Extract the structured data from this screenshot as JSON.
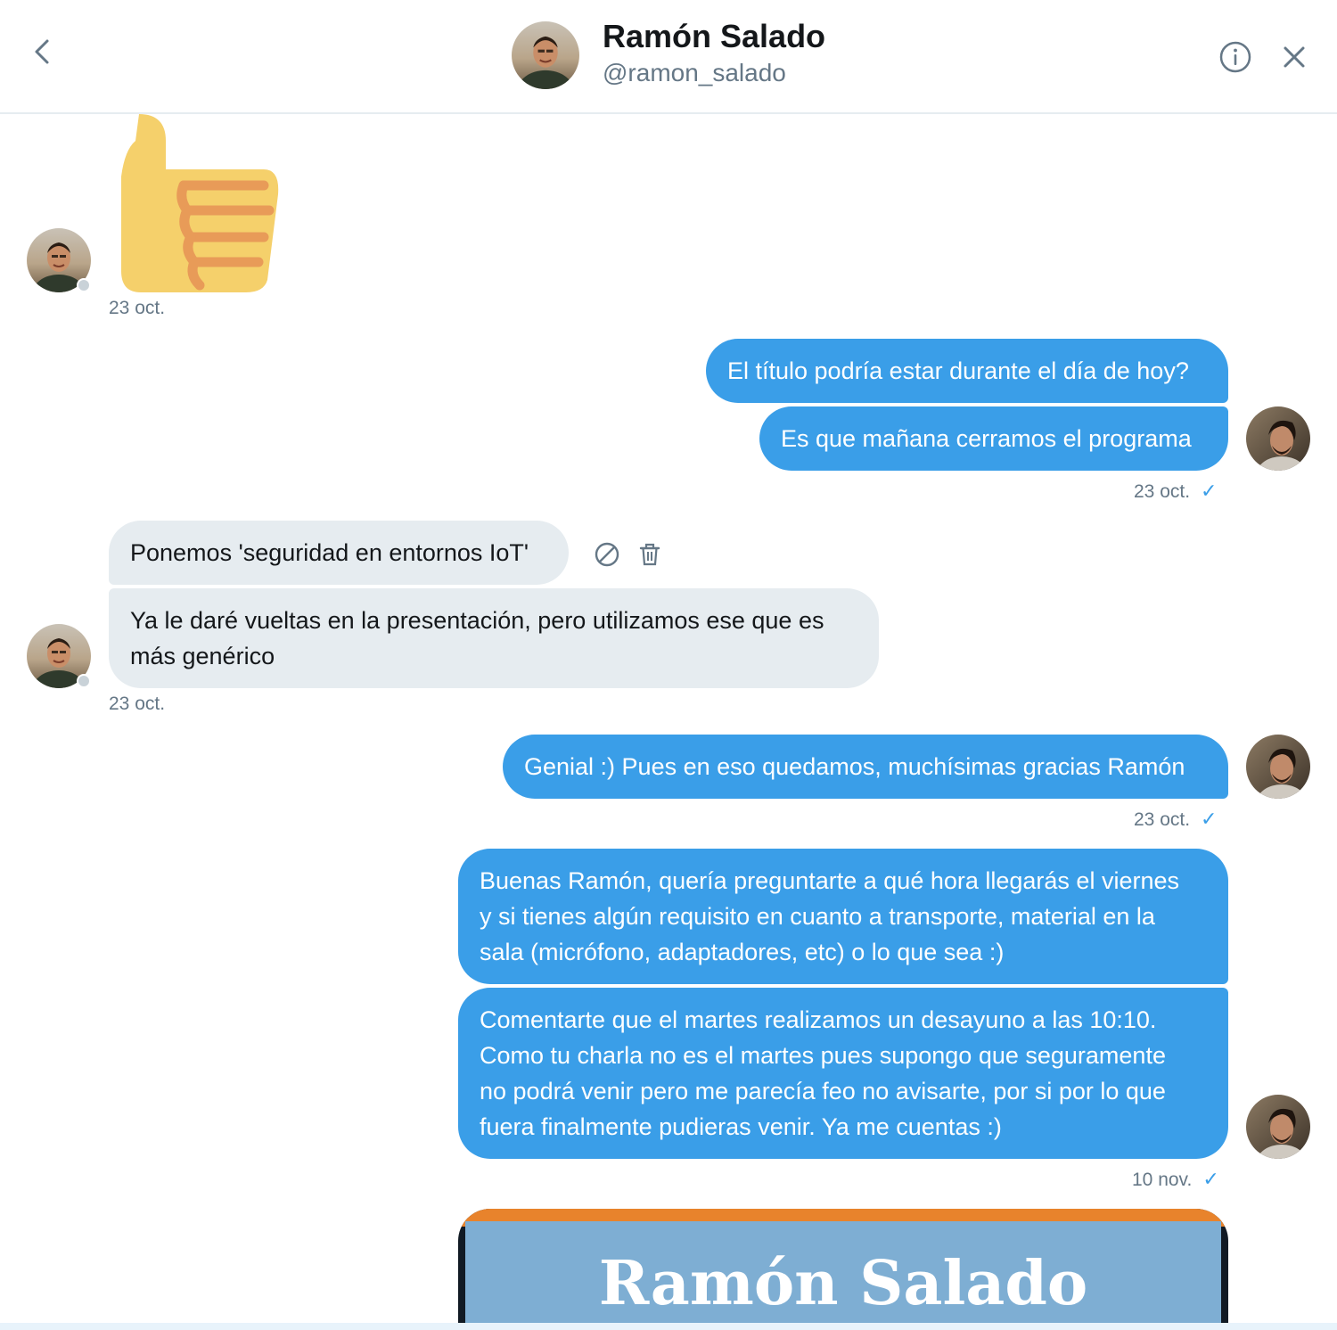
{
  "header": {
    "name": "Ramón Salado",
    "handle": "@ramon_salado"
  },
  "messages": [
    {
      "id": "m1",
      "direction": "incoming",
      "type": "emoji",
      "emoji": "thumbs-up",
      "timestamp": "23 oct."
    },
    {
      "id": "m2",
      "direction": "outgoing",
      "text": "El título podría estar durante el día de hoy?"
    },
    {
      "id": "m3",
      "direction": "outgoing",
      "text": "Es que mañana cerramos el programa",
      "timestamp": "23 oct."
    },
    {
      "id": "m4",
      "direction": "incoming",
      "text": "Ponemos 'seguridad en entornos IoT'"
    },
    {
      "id": "m5",
      "direction": "incoming",
      "text": "Ya le daré vueltas en la presentación, pero utilizamos ese que es\nmás genérico",
      "timestamp": "23 oct."
    },
    {
      "id": "m6",
      "direction": "outgoing",
      "text": "Genial :) Pues en eso quedamos, muchísimas gracias Ramón",
      "timestamp": "23 oct."
    },
    {
      "id": "m7",
      "direction": "outgoing",
      "text": "Buenas Ramón, quería preguntarte a qué hora llegarás el viernes\ny si tienes algún requisito en cuanto a transporte, material en la\nsala (micrófono, adaptadores, etc) o lo que sea :)"
    },
    {
      "id": "m8",
      "direction": "outgoing",
      "text": "Comentarte que el martes realizamos un desayuno a las 10:10.\nComo tu charla no es el martes pues supongo que seguramente\nno podrá venir pero me parecía feo no avisarte, por si por lo que\nfuera finalmente pudieras venir. Ya me cuentas :)",
      "timestamp": "10 nov."
    }
  ],
  "preview_card": {
    "title": "Ramón Salado"
  },
  "read_check": "✓",
  "colors": {
    "outgoing_bubble": "#3a9ee8",
    "incoming_bubble": "#e6ecf0",
    "accent": "#1da1f2"
  },
  "icons": [
    "back-chevron-icon",
    "info-icon",
    "close-icon",
    "block-icon",
    "trash-icon",
    "thumbs-up-emoji"
  ]
}
